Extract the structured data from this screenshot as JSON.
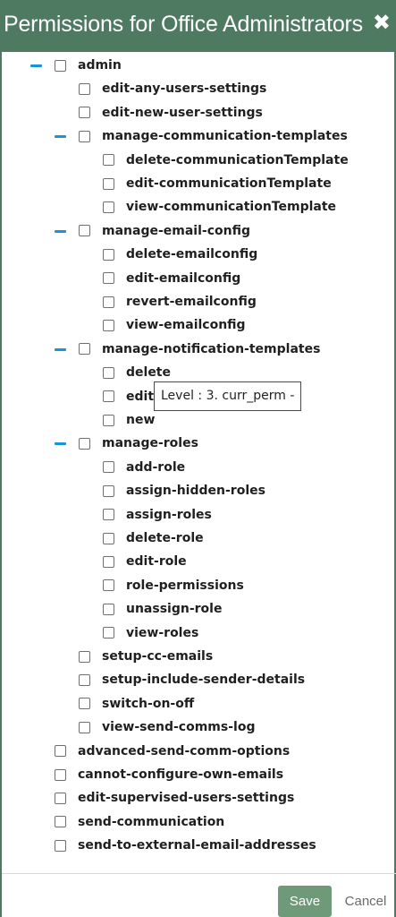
{
  "dialog": {
    "title": "Permissions for Office Administrators",
    "close_glyph": "✖",
    "close_icon": "close-icon"
  },
  "tree": {
    "collapse_icon": "collapse-minus-icon",
    "items": [
      {
        "label": "admin",
        "level": 0,
        "expanded": true
      },
      {
        "label": "edit-any-users-settings",
        "level": 1
      },
      {
        "label": "edit-new-user-settings",
        "level": 1
      },
      {
        "label": "manage-communication-templates",
        "level": 1,
        "expanded": true
      },
      {
        "label": "delete-communicationTemplate",
        "level": 2
      },
      {
        "label": "edit-communicationTemplate",
        "level": 2
      },
      {
        "label": "view-communicationTemplate",
        "level": 2
      },
      {
        "label": "manage-email-config",
        "level": 1,
        "expanded": true
      },
      {
        "label": "delete-emailconfig",
        "level": 2
      },
      {
        "label": "edit-emailconfig",
        "level": 2
      },
      {
        "label": "revert-emailconfig",
        "level": 2
      },
      {
        "label": "view-emailconfig",
        "level": 2
      },
      {
        "label": "manage-notification-templates",
        "level": 1,
        "expanded": true
      },
      {
        "label": "delete",
        "level": 2
      },
      {
        "label": "edit",
        "level": 2
      },
      {
        "label": "new",
        "level": 2
      },
      {
        "label": "manage-roles",
        "level": 1,
        "expanded": true
      },
      {
        "label": "add-role",
        "level": 2
      },
      {
        "label": "assign-hidden-roles",
        "level": 2
      },
      {
        "label": "assign-roles",
        "level": 2
      },
      {
        "label": "delete-role",
        "level": 2
      },
      {
        "label": "edit-role",
        "level": 2
      },
      {
        "label": "role-permissions",
        "level": 2
      },
      {
        "label": "unassign-role",
        "level": 2
      },
      {
        "label": "view-roles",
        "level": 2
      },
      {
        "label": "setup-cc-emails",
        "level": 1
      },
      {
        "label": "setup-include-sender-details",
        "level": 1
      },
      {
        "label": "switch-on-off",
        "level": 1
      },
      {
        "label": "view-send-comms-log",
        "level": 1
      },
      {
        "label": "advanced-send-comm-options",
        "level": 0
      },
      {
        "label": "cannot-configure-own-emails",
        "level": 0
      },
      {
        "label": "edit-supervised-users-settings",
        "level": 0
      },
      {
        "label": "send-communication",
        "level": 0
      },
      {
        "label": "send-to-external-email-addresses",
        "level": 0
      }
    ]
  },
  "tooltip": {
    "text": "Level : 3. curr_perm -"
  },
  "footer": {
    "save_label": "Save",
    "cancel_label": "Cancel"
  }
}
